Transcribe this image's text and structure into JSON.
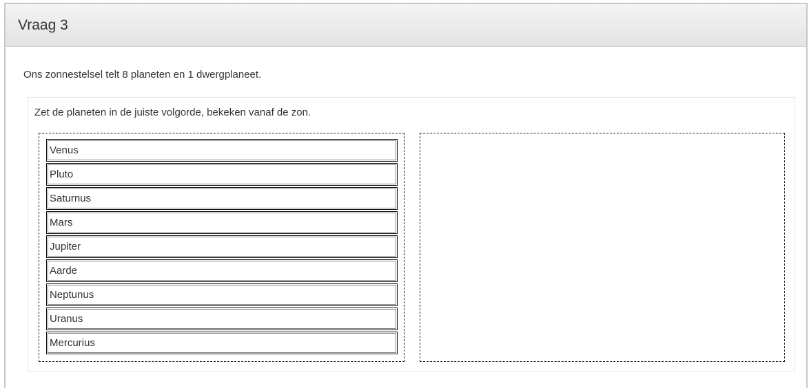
{
  "question": {
    "title": "Vraag 3",
    "intro": "Ons zonnestelsel telt 8 planeten en 1 dwergplaneet.",
    "instruction": "Zet de planeten in de juiste volgorde, bekeken vanaf de zon."
  },
  "source_items": [
    {
      "label": "Venus"
    },
    {
      "label": "Pluto"
    },
    {
      "label": "Saturnus"
    },
    {
      "label": "Mars"
    },
    {
      "label": "Jupiter"
    },
    {
      "label": "Aarde"
    },
    {
      "label": "Neptunus"
    },
    {
      "label": "Uranus"
    },
    {
      "label": "Mercurius"
    }
  ],
  "target_items": []
}
